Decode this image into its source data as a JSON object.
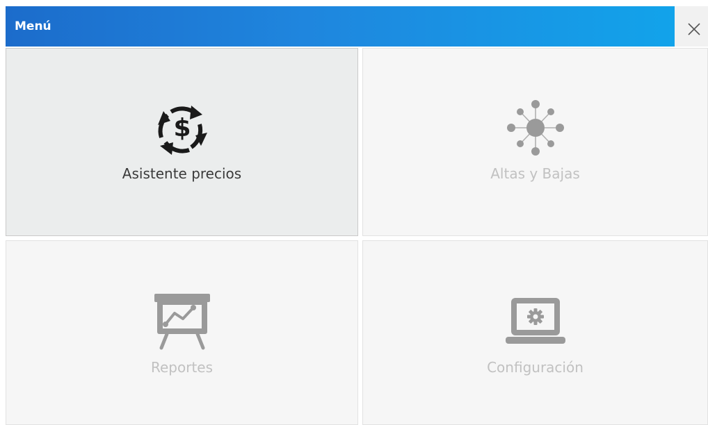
{
  "window": {
    "title": "Menú",
    "close_icon": "close-icon"
  },
  "tiles": [
    {
      "label": "Asistente precios",
      "icon": "dollar-cycle-icon",
      "state": "active"
    },
    {
      "label": "Altas y Bajas",
      "icon": "network-hub-icon",
      "state": "inactive"
    },
    {
      "label": "Reportes",
      "icon": "presentation-chart-icon",
      "state": "inactive"
    },
    {
      "label": "Configuración",
      "icon": "laptop-gear-icon",
      "state": "inactive"
    }
  ],
  "colors": {
    "titlebar_start": "#1c6ccb",
    "titlebar_end": "#12a3ea",
    "active_tile_bg": "#ebeded",
    "tile_bg": "#f6f6f6",
    "active_text": "#3a3a3a",
    "inactive_text": "#c1c1c1",
    "inactive_icon": "#999999"
  }
}
